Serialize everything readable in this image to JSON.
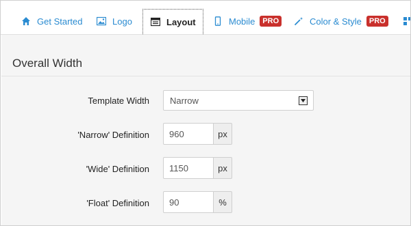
{
  "tabs": [
    {
      "label": "Get Started",
      "icon": "home-icon",
      "active": false,
      "badge": ""
    },
    {
      "label": "Logo",
      "icon": "image-icon",
      "active": false,
      "badge": ""
    },
    {
      "label": "Layout",
      "icon": "layout-icon",
      "active": true,
      "badge": ""
    },
    {
      "label": "Mobile",
      "icon": "mobile-icon",
      "active": false,
      "badge": "PRO"
    },
    {
      "label": "Color & Style",
      "icon": "magic-wand-icon",
      "active": false,
      "badge": "PRO"
    }
  ],
  "section": {
    "title": "Overall Width"
  },
  "fields": {
    "template_width": {
      "label": "Template Width",
      "value": "Narrow"
    },
    "narrow": {
      "label": "'Narrow' Definition",
      "value": "960",
      "unit": "px"
    },
    "wide": {
      "label": "'Wide' Definition",
      "value": "1150",
      "unit": "px"
    },
    "float": {
      "label": "'Float' Definition",
      "value": "90",
      "unit": "%"
    }
  },
  "colors": {
    "link": "#2a8bd1",
    "badge": "#c9302c",
    "panel_bg": "#f5f5f5"
  }
}
